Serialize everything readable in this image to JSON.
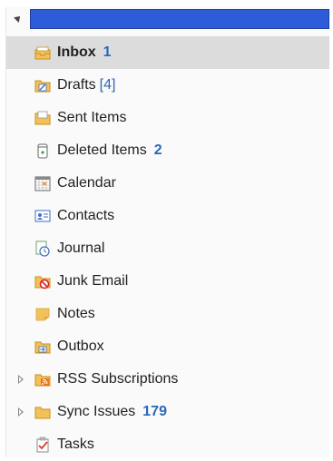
{
  "account": {
    "name": ""
  },
  "folders": [
    {
      "label": "Inbox",
      "count": "1",
      "icon": "inbox-icon",
      "selected": true
    },
    {
      "label": "Drafts",
      "count": "[4]",
      "icon": "drafts-icon"
    },
    {
      "label": "Sent Items",
      "count": "",
      "icon": "sent-items-icon"
    },
    {
      "label": "Deleted Items",
      "count": "2",
      "icon": "deleted-items-icon"
    },
    {
      "label": "Calendar",
      "count": "",
      "icon": "calendar-icon"
    },
    {
      "label": "Contacts",
      "count": "",
      "icon": "contacts-icon"
    },
    {
      "label": "Journal",
      "count": "",
      "icon": "journal-icon"
    },
    {
      "label": "Junk Email",
      "count": "",
      "icon": "junk-email-icon"
    },
    {
      "label": "Notes",
      "count": "",
      "icon": "notes-icon"
    },
    {
      "label": "Outbox",
      "count": "",
      "icon": "outbox-icon"
    },
    {
      "label": "RSS Subscriptions",
      "count": "",
      "icon": "rss-icon",
      "expandable": true
    },
    {
      "label": "Sync Issues",
      "count": "179",
      "icon": "sync-issues-icon",
      "expandable": true
    },
    {
      "label": "Tasks",
      "count": "",
      "icon": "tasks-icon"
    }
  ],
  "colors": {
    "account_bar": "#2e5bd8",
    "count": "#2a68b8",
    "selected_bg": "#dcdcdc"
  }
}
